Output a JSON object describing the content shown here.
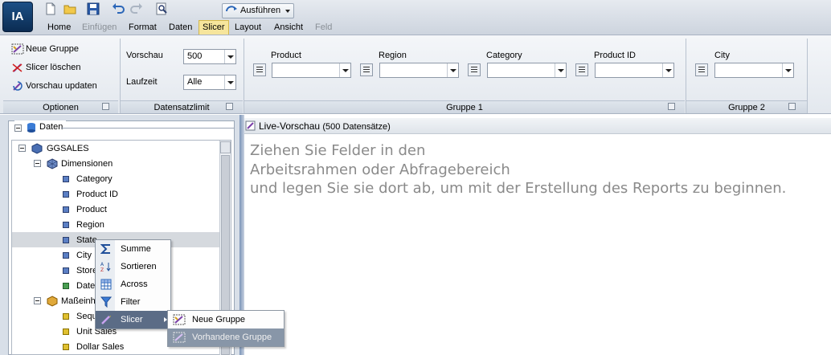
{
  "app": {
    "logo_text": "IA"
  },
  "quick_access": {
    "icons": [
      "new-document-icon",
      "open-folder-icon",
      "save-icon",
      "undo-icon",
      "redo-icon",
      "print-preview-icon"
    ],
    "run_label": "Ausführen"
  },
  "tabs": [
    {
      "label": "Home",
      "state": "normal"
    },
    {
      "label": "Einfügen",
      "state": "disabled"
    },
    {
      "label": "Format",
      "state": "normal"
    },
    {
      "label": "Daten",
      "state": "normal"
    },
    {
      "label": "Slicer",
      "state": "active"
    },
    {
      "label": "Layout",
      "state": "normal"
    },
    {
      "label": "Ansicht",
      "state": "normal"
    },
    {
      "label": "Feld",
      "state": "disabled"
    }
  ],
  "ribbon": {
    "optionen": {
      "new_group": "Neue Gruppe",
      "clear_slicer": "Slicer löschen",
      "update_preview": "Vorschau updaten",
      "label": "Optionen"
    },
    "datensatzlimit": {
      "vorschau_label": "Vorschau",
      "vorschau_value": "500",
      "laufzeit_label": "Laufzeit",
      "laufzeit_value": "Alle",
      "label": "Datensatzlimit"
    },
    "gruppe1": {
      "label": "Gruppe 1",
      "fields": [
        {
          "label": "Product",
          "value": ""
        },
        {
          "label": "Region",
          "value": ""
        },
        {
          "label": "Category",
          "value": ""
        },
        {
          "label": "Product ID",
          "value": ""
        }
      ]
    },
    "gruppe2": {
      "label": "Gruppe 2",
      "fields": [
        {
          "label": "City",
          "value": ""
        }
      ]
    }
  },
  "data_panel": {
    "title": "Daten",
    "root": "GGSALES",
    "dimensions_label": "Dimensionen",
    "dimensions": [
      "Category",
      "Product ID",
      "Product",
      "Region",
      "State",
      "City",
      "Store",
      "Date"
    ],
    "measures_label": "Maßeinheiten",
    "measures": [
      "Sequence",
      "Unit Sales",
      "Dollar Sales"
    ]
  },
  "preview": {
    "title": "Live-Vorschau",
    "count": "(500 Datensätze)",
    "hint_lines": [
      "Ziehen Sie Felder in den",
      "Arbeitsrahmen oder Abfragebereich",
      "und legen Sie sie dort ab, um mit der Erstellung des Reports zu beginnen."
    ]
  },
  "context_menu": {
    "items": [
      "Summe",
      "Sortieren",
      "Across",
      "Filter",
      "Slicer"
    ],
    "submenu": [
      "Neue Gruppe",
      "Vorhandene Gruppe"
    ]
  }
}
